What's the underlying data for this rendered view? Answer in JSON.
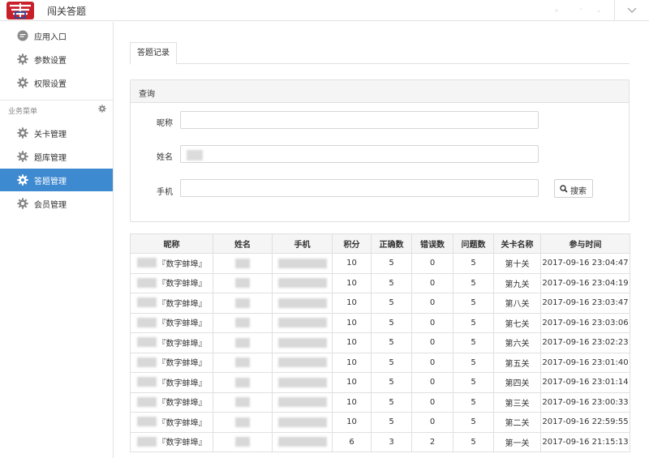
{
  "header": {
    "app_title": "闯关答题"
  },
  "sidebar": {
    "top_items": [
      {
        "label": "应用入口",
        "icon": "chat-bubble-icon"
      },
      {
        "label": "参数设置",
        "icon": "gear-icon"
      },
      {
        "label": "权限设置",
        "icon": "gear-icon"
      }
    ],
    "section_label": "业务菜单",
    "business_items": [
      {
        "label": "关卡管理",
        "icon": "gear-icon",
        "active": false
      },
      {
        "label": "题库管理",
        "icon": "gear-icon",
        "active": false
      },
      {
        "label": "答题管理",
        "icon": "gear-icon",
        "active": true
      },
      {
        "label": "会员管理",
        "icon": "gear-icon",
        "active": false
      }
    ]
  },
  "tabs": [
    {
      "label": "答题记录",
      "active": true
    }
  ],
  "query": {
    "title": "查询",
    "fields": {
      "nickname_label": "昵称",
      "name_label": "姓名",
      "phone_label": "手机"
    },
    "search_label": "搜索"
  },
  "colors": {
    "active_nav": "#3e8ad0",
    "header_bg": "#f5f5f5",
    "border": "#e0e0e0"
  },
  "table": {
    "columns": [
      "昵称",
      "姓名",
      "手机",
      "积分",
      "正确数",
      "错误数",
      "问题数",
      "关卡名称",
      "参与时间"
    ],
    "rows": [
      {
        "nick": "『数字蚌埠』",
        "score": "10",
        "correct": "5",
        "wrong": "0",
        "questions": "5",
        "level": "第十关",
        "time": "2017-09-16 23:04:47"
      },
      {
        "nick": "『数字蚌埠』",
        "score": "10",
        "correct": "5",
        "wrong": "0",
        "questions": "5",
        "level": "第九关",
        "time": "2017-09-16 23:04:19"
      },
      {
        "nick": "『数字蚌埠』",
        "score": "10",
        "correct": "5",
        "wrong": "0",
        "questions": "5",
        "level": "第八关",
        "time": "2017-09-16 23:03:47"
      },
      {
        "nick": "『数字蚌埠』",
        "score": "10",
        "correct": "5",
        "wrong": "0",
        "questions": "5",
        "level": "第七关",
        "time": "2017-09-16 23:03:06"
      },
      {
        "nick": "『数字蚌埠』",
        "score": "10",
        "correct": "5",
        "wrong": "0",
        "questions": "5",
        "level": "第六关",
        "time": "2017-09-16 23:02:23"
      },
      {
        "nick": "『数字蚌埠』",
        "score": "10",
        "correct": "5",
        "wrong": "0",
        "questions": "5",
        "level": "第五关",
        "time": "2017-09-16 23:01:40"
      },
      {
        "nick": "『数字蚌埠』",
        "score": "10",
        "correct": "5",
        "wrong": "0",
        "questions": "5",
        "level": "第四关",
        "time": "2017-09-16 23:01:14"
      },
      {
        "nick": "『数字蚌埠』",
        "score": "10",
        "correct": "5",
        "wrong": "0",
        "questions": "5",
        "level": "第三关",
        "time": "2017-09-16 23:00:33"
      },
      {
        "nick": "『数字蚌埠』",
        "score": "10",
        "correct": "5",
        "wrong": "0",
        "questions": "5",
        "level": "第二关",
        "time": "2017-09-16 22:59:55"
      },
      {
        "nick": "『数字蚌埠』",
        "score": "6",
        "correct": "3",
        "wrong": "2",
        "questions": "5",
        "level": "第一关",
        "time": "2017-09-16 21:15:13"
      }
    ]
  }
}
